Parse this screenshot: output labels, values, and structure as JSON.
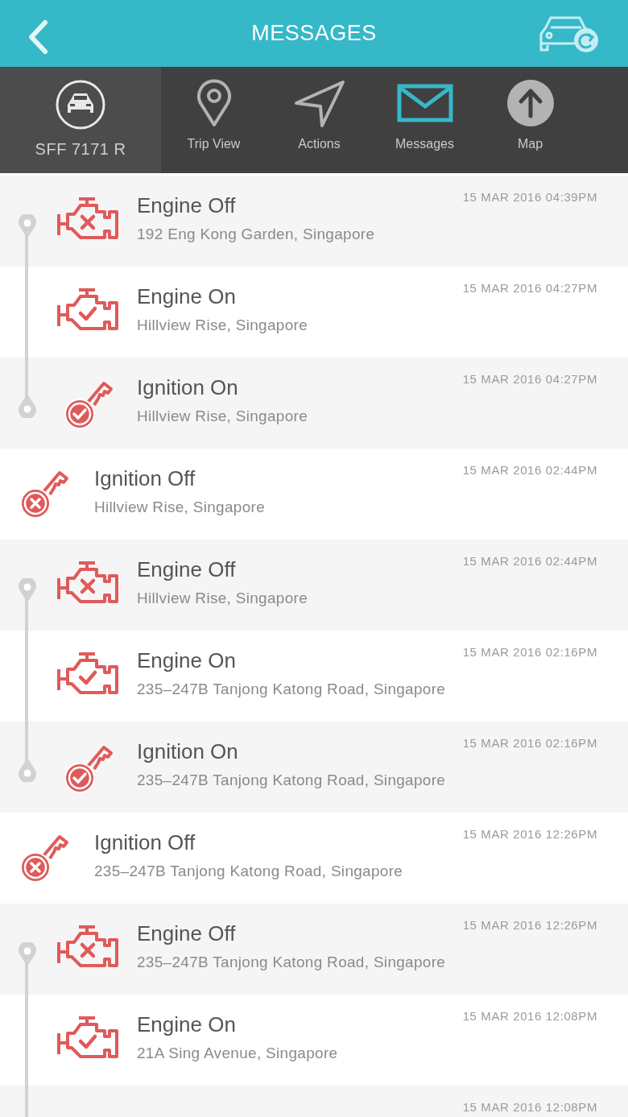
{
  "header": {
    "title": "MESSAGES"
  },
  "vehicle": {
    "plate": "SFF 7171 R"
  },
  "tabs": [
    {
      "label": "Trip View",
      "kind": "pin",
      "selected": false
    },
    {
      "label": "Actions",
      "kind": "arrow",
      "selected": false
    },
    {
      "label": "Messages",
      "kind": "envelope",
      "selected": true
    },
    {
      "label": "Map",
      "kind": "up",
      "selected": false
    }
  ],
  "timeline": [
    {
      "kind": "trip",
      "complete": true,
      "events": [
        {
          "kind": "engine_off",
          "title": "Engine Off",
          "address": "192 Eng Kong Garden, Singapore",
          "time": "15 MAR 2016 04:39PM"
        },
        {
          "kind": "engine_on",
          "title": "Engine On",
          "address": "Hillview Rise, Singapore",
          "time": "15 MAR 2016 04:27PM"
        },
        {
          "kind": "ignition_on",
          "title": "Ignition On",
          "address": "Hillview Rise, Singapore",
          "time": "15 MAR 2016 04:27PM"
        }
      ]
    },
    {
      "kind": "event",
      "event": {
        "kind": "ignition_off",
        "title": "Ignition Off",
        "address": "Hillview Rise, Singapore",
        "time": "15 MAR 2016 02:44PM"
      }
    },
    {
      "kind": "trip",
      "complete": true,
      "events": [
        {
          "kind": "engine_off",
          "title": "Engine Off",
          "address": "Hillview Rise, Singapore",
          "time": "15 MAR 2016 02:44PM"
        },
        {
          "kind": "engine_on",
          "title": "Engine On",
          "address": "235–247B Tanjong Katong Road, Singapore",
          "time": "15 MAR 2016 02:16PM"
        },
        {
          "kind": "ignition_on",
          "title": "Ignition On",
          "address": "235–247B Tanjong Katong Road, Singapore",
          "time": "15 MAR 2016 02:16PM"
        }
      ]
    },
    {
      "kind": "event",
      "event": {
        "kind": "ignition_off",
        "title": "Ignition Off",
        "address": "235–247B Tanjong Katong Road, Singapore",
        "time": "15 MAR 2016 12:26PM"
      }
    },
    {
      "kind": "trip",
      "events": [
        {
          "kind": "engine_off",
          "title": "Engine Off",
          "address": "235–247B Tanjong Katong Road, Singapore",
          "time": "15 MAR 2016 12:26PM"
        },
        {
          "kind": "engine_on",
          "title": "Engine On",
          "address": "21A Sing Avenue, Singapore",
          "time": "15 MAR 2016 12:08PM"
        },
        {
          "kind": "cut_off",
          "time": "15 MAR 2016 12:08PM"
        }
      ]
    }
  ]
}
